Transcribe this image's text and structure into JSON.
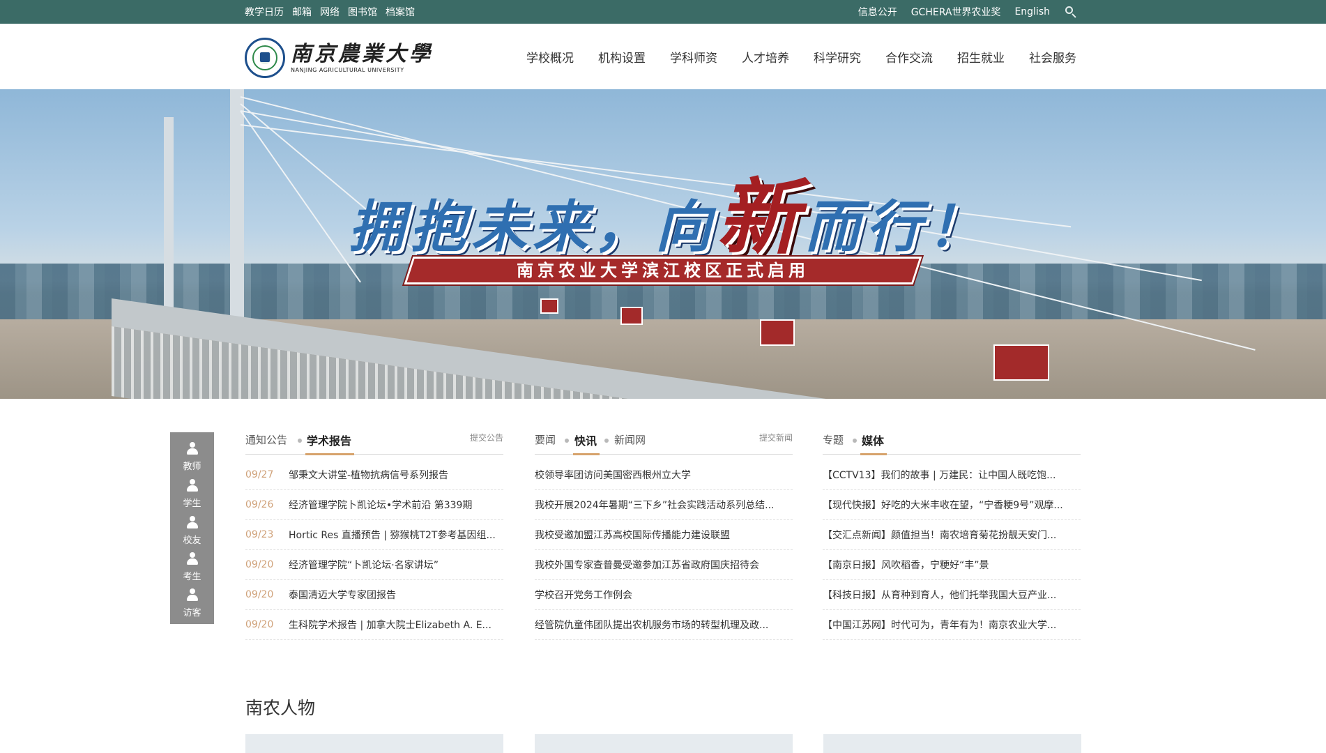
{
  "topbar": {
    "left_links": [
      "教学日历",
      "邮箱",
      "网络",
      "图书馆",
      "档案馆"
    ],
    "right_links": [
      "信息公开",
      "GCHERA世界农业奖",
      "English"
    ],
    "search_icon": "search-icon"
  },
  "header": {
    "logo_cn": "南京農業大學",
    "logo_en": "NANJING AGRICULTURAL UNIVERSITY",
    "nav": [
      "学校概况",
      "机构设置",
      "学科师资",
      "人才培养",
      "科学研究",
      "合作交流",
      "招生就业",
      "社会服务"
    ]
  },
  "hero": {
    "slogan_part1": "拥抱未来，向",
    "slogan_accent": "新",
    "slogan_part2": "而行！",
    "ribbon": "南京农业大学滨江校区正式启用"
  },
  "quick_links": [
    {
      "label": "教师",
      "icon": "teacher-icon"
    },
    {
      "label": "学生",
      "icon": "student-icon"
    },
    {
      "label": "校友",
      "icon": "alumni-icon"
    },
    {
      "label": "考生",
      "icon": "examinee-icon"
    },
    {
      "label": "访客",
      "icon": "visitor-icon"
    }
  ],
  "columns": [
    {
      "tabs": [
        "通知公告",
        "学术报告"
      ],
      "active": 1,
      "submit": "提交公告",
      "items": [
        {
          "date": "09/27",
          "title": "邹秉文大讲堂-植物抗病信号系列报告"
        },
        {
          "date": "09/26",
          "title": "经济管理学院卜凯论坛•学术前沿 第339期"
        },
        {
          "date": "09/23",
          "title": "Hortic Res 直播预告 | 猕猴桃T2T参考基因组..."
        },
        {
          "date": "09/20",
          "title": "经济管理学院“卜凯论坛·名家讲坛”"
        },
        {
          "date": "09/20",
          "title": "泰国清迈大学专家团报告"
        },
        {
          "date": "09/20",
          "title": "生科院学术报告 | 加拿大院士Elizabeth A. E..."
        }
      ]
    },
    {
      "tabs": [
        "要闻",
        "快讯",
        "新闻网"
      ],
      "active": 1,
      "submit": "提交新闻",
      "items": [
        {
          "date": "",
          "title": "校领导率团访问美国密西根州立大学"
        },
        {
          "date": "",
          "title": "我校开展2024年暑期“三下乡”社会实践活动系列总结..."
        },
        {
          "date": "",
          "title": "我校受邀加盟江苏高校国际传播能力建设联盟"
        },
        {
          "date": "",
          "title": "我校外国专家查普曼受邀参加江苏省政府国庆招待会"
        },
        {
          "date": "",
          "title": "学校召开党务工作例会"
        },
        {
          "date": "",
          "title": "经管院仇童伟团队提出农机服务市场的转型机理及政..."
        }
      ]
    },
    {
      "tabs": [
        "专题",
        "媒体"
      ],
      "active": 1,
      "submit": "",
      "items": [
        {
          "date": "",
          "title": "【CCTV13】我们的故事 | 万建民：让中国人既吃饱..."
        },
        {
          "date": "",
          "title": "【现代快报】好吃的大米丰收在望，“宁香粳9号”观摩..."
        },
        {
          "date": "",
          "title": "【交汇点新闻】颜值担当！南农培育菊花扮靓天安门..."
        },
        {
          "date": "",
          "title": "【南京日报】风吹稻香，宁粳好“丰”景"
        },
        {
          "date": "",
          "title": "【科技日报】从育种到育人，他们托举我国大豆产业..."
        },
        {
          "date": "",
          "title": "【中国江苏网】时代可为，青年有为！南京农业大学..."
        }
      ]
    }
  ],
  "people": {
    "title": "南农人物"
  },
  "colors": {
    "topbar": "#3b6b66",
    "accent_date": "#d0a27a",
    "tab_underline": "#d7a36c",
    "sidebar": "#8c8c8c"
  }
}
